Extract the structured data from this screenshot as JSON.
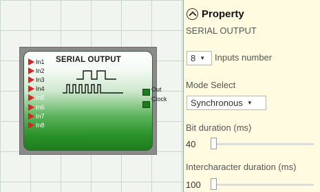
{
  "block": {
    "title": "SERIAL OUTPUT",
    "inputs": [
      "In1",
      "In2",
      "In3",
      "In4",
      "In5",
      "In6",
      "In7",
      "In8"
    ],
    "outputs": [
      "Out",
      "Clock"
    ]
  },
  "panel": {
    "header": "Property",
    "block_name": "SERIAL OUTPUT",
    "inputs_number": {
      "value": "8",
      "label": "Inputs number"
    },
    "mode_select": {
      "label": "Mode Select",
      "value": "Synchronous"
    },
    "bit_duration": {
      "label": "Bit duration (ms)",
      "value": "40"
    },
    "intercharacter_duration": {
      "label": "Intercharacter duration (ms)",
      "value": "100"
    }
  },
  "colors": {
    "panel_bg": "#fffbe0",
    "pin_arrow": "#e02020",
    "block_green": "#2a922a"
  },
  "icons": {
    "collapse": "chevron-up-circle-icon",
    "dropdown": "caret-down-icon"
  }
}
